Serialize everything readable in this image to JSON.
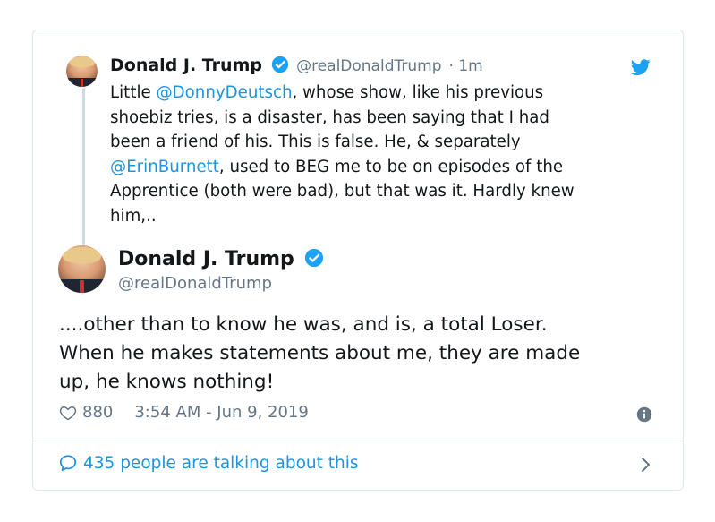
{
  "quoted_tweet": {
    "name": "Donald J. Trump",
    "handle": "@realDonaldTrump",
    "time": "· 1m",
    "lines": [
      [
        {
          "t": "Little "
        },
        {
          "t": "@DonnyDeutsch",
          "m": true
        },
        {
          "t": ", whose show, like his previous"
        }
      ],
      [
        {
          "t": "shoebiz tries, is a disaster, has been saying that I had"
        }
      ],
      [
        {
          "t": "been a friend of his. This is false. He, & separately"
        }
      ],
      [
        {
          "t": "@ErinBurnett",
          "m": true
        },
        {
          "t": ", used to BEG me to be on episodes of the"
        }
      ],
      [
        {
          "t": "Apprentice (both were bad), but that was it. Hardly knew"
        }
      ],
      [
        {
          "t": "him,.."
        }
      ]
    ]
  },
  "main_tweet": {
    "name": "Donald J. Trump",
    "handle": "@realDonaldTrump",
    "lines": [
      "....other than to know he was, and is, a total Loser.",
      "When he makes statements about me, they are made",
      "up, he knows nothing!"
    ],
    "likes": "880",
    "timestamp": "3:54 AM - Jun 9, 2019"
  },
  "footer": {
    "talking": "435 people are talking about this"
  },
  "colors": {
    "accent": "#1b95e0",
    "muted": "#657786",
    "border": "#e1e8ed"
  },
  "icons": [
    "verified-badge-icon",
    "twitter-bird-icon",
    "heart-icon",
    "info-icon",
    "comment-bubble-icon",
    "chevron-right-icon"
  ]
}
